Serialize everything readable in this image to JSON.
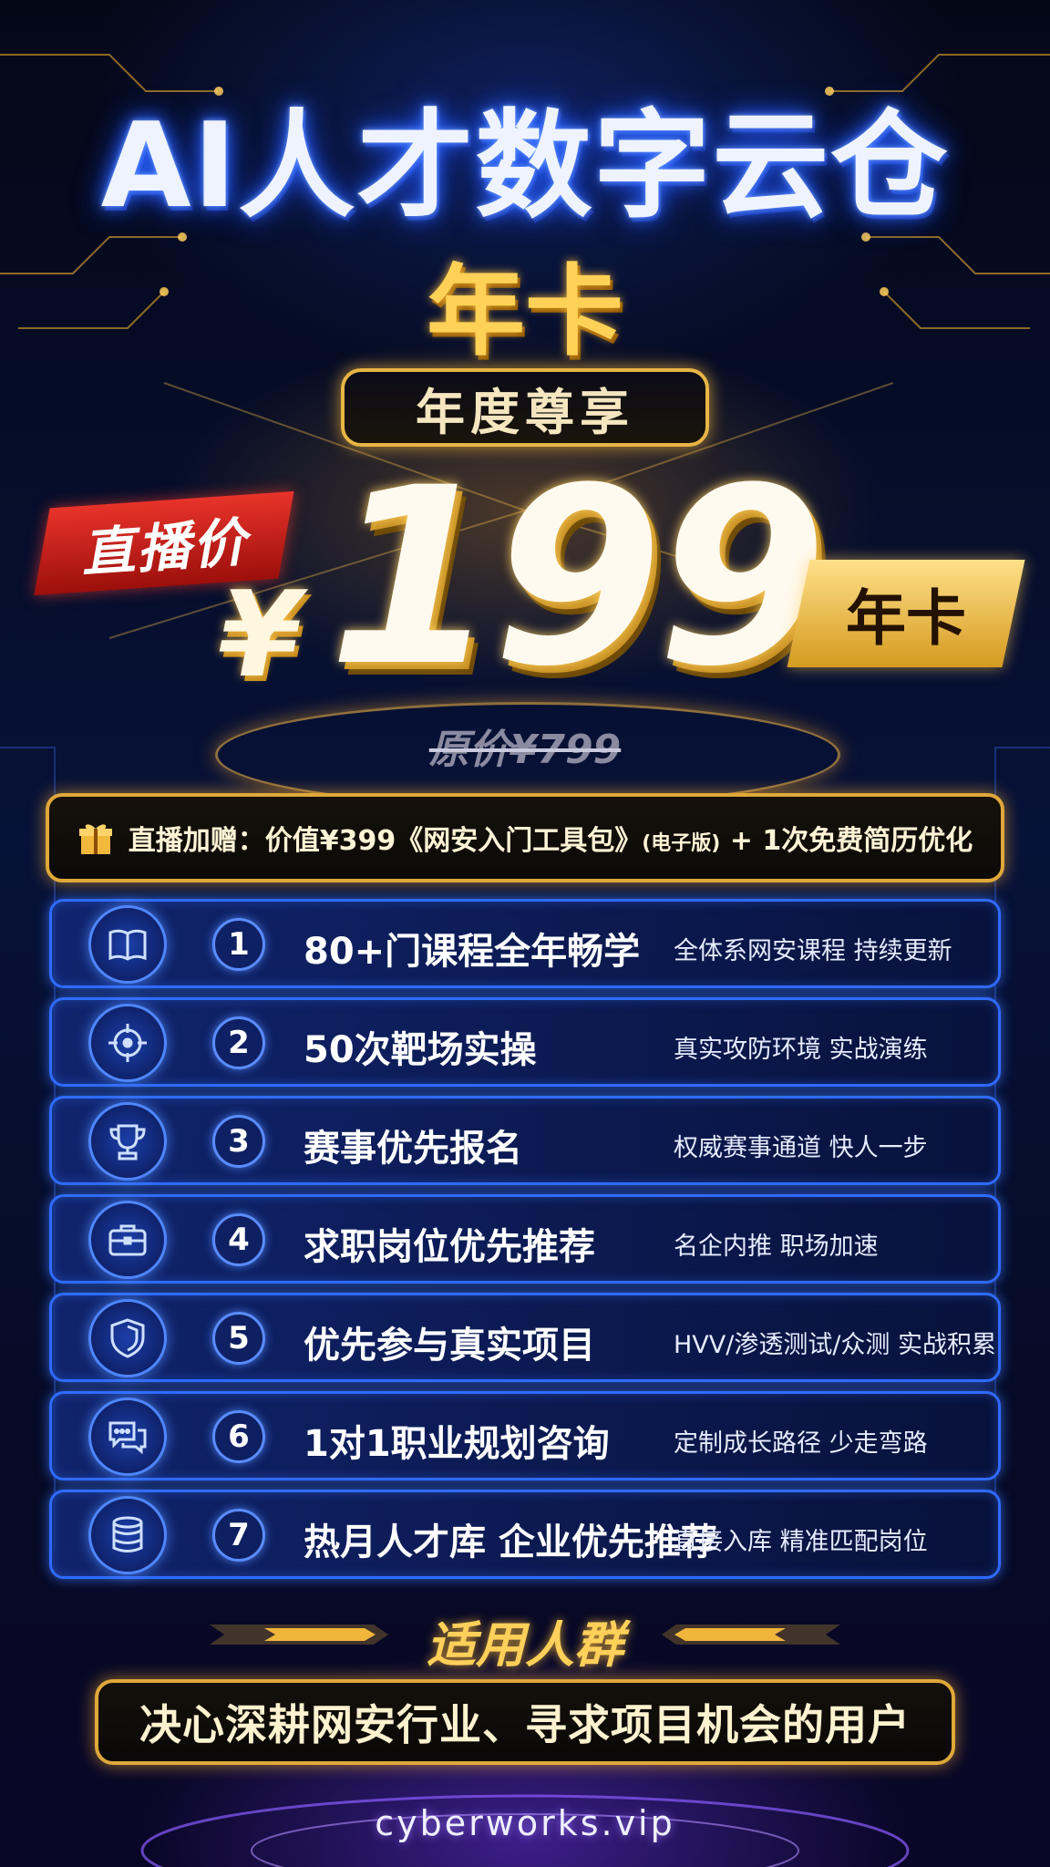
{
  "header": {
    "title": "AI人才数字云仓",
    "card_label": "年卡",
    "badge": "年度尊享"
  },
  "price": {
    "live_tag": "直播价",
    "currency": "¥",
    "amount": "199",
    "unit_tag": "年卡",
    "original": "原价¥799"
  },
  "bonus": {
    "icon": "gift-icon",
    "text_main": "直播加赠：价值¥399《网安入门工具包》",
    "text_small": "(电子版)",
    "text_tail": " + 1次免费简历优化"
  },
  "benefits": [
    {
      "num": "1",
      "icon": "book-icon",
      "title": "80+门课程全年畅学",
      "desc": "全体系网安课程 持续更新"
    },
    {
      "num": "2",
      "icon": "target-icon",
      "title": "50次靶场实操",
      "desc": "真实攻防环境 实战演练"
    },
    {
      "num": "3",
      "icon": "trophy-icon",
      "title": "赛事优先报名",
      "desc": "权威赛事通道 快人一步"
    },
    {
      "num": "4",
      "icon": "briefcase-icon",
      "title": "求职岗位优先推荐",
      "desc": "名企内推 职场加速"
    },
    {
      "num": "5",
      "icon": "shield-icon",
      "title": "优先参与真实项目",
      "desc": "HVV/渗透测试/众测 实战积累"
    },
    {
      "num": "6",
      "icon": "chat-icon",
      "title": "1对1职业规划咨询",
      "desc": "定制成长路径 少走弯路"
    },
    {
      "num": "7",
      "icon": "database-icon",
      "title": "热月人才库 企业优先推荐",
      "desc": "直接入库 精准匹配岗位"
    }
  ],
  "audience": {
    "title": "适用人群",
    "text": "决心深耕网安行业、寻求项目机会的用户"
  },
  "footer": {
    "site": "cyberworks.vip"
  },
  "colors": {
    "gold": "#ffd257",
    "blue_glow": "#2f6bff",
    "red_tag": "#e8332a"
  }
}
